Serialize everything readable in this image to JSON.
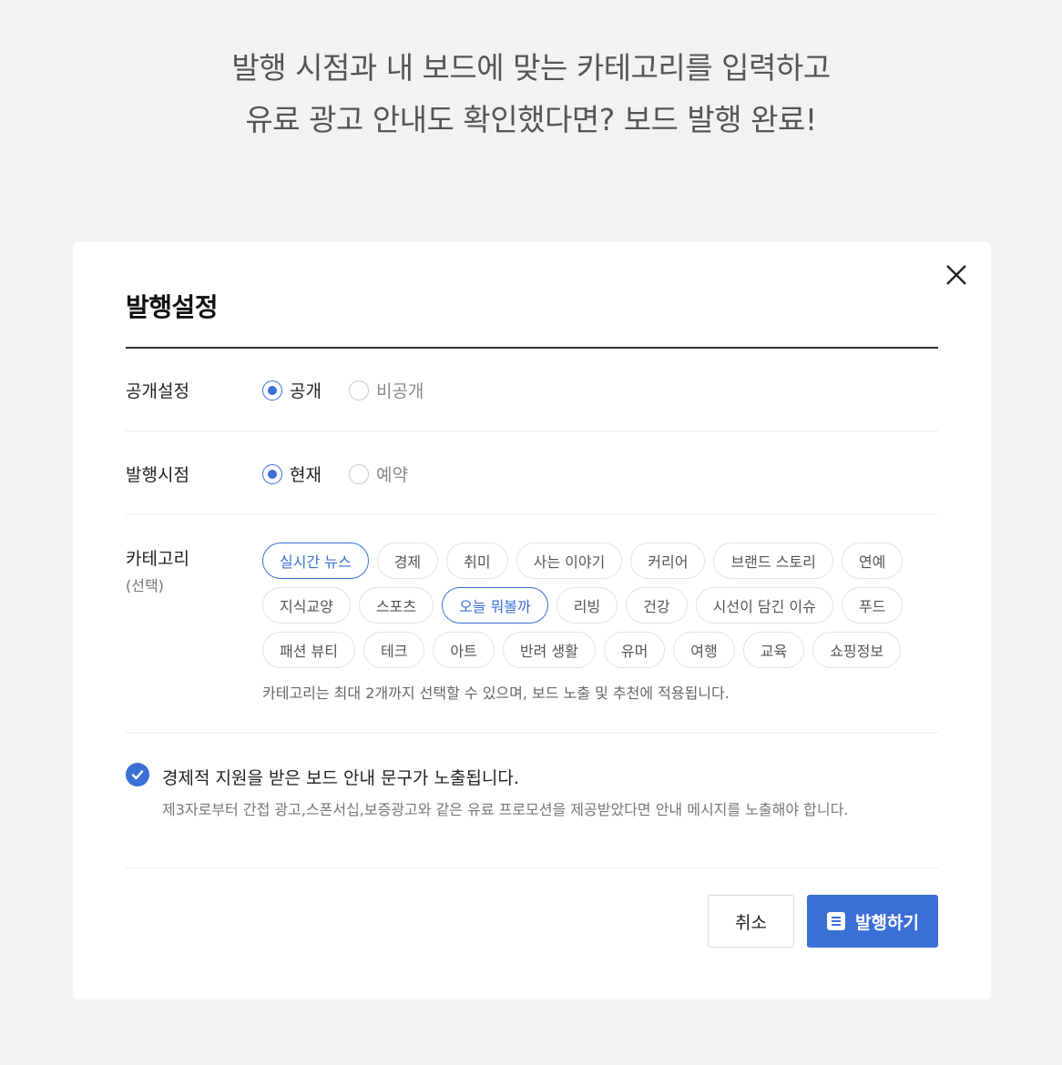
{
  "headline": {
    "line1": "발행 시점과 내 보드에 맞는 카테고리를 입력하고",
    "line2": "유료 광고 안내도 확인했다면? 보드 발행 완료!"
  },
  "modal": {
    "title": "발행설정",
    "close_icon": "close-icon",
    "visibility": {
      "label": "공개설정",
      "options": [
        {
          "label": "공개",
          "selected": true
        },
        {
          "label": "비공개",
          "selected": false
        }
      ]
    },
    "publish_time": {
      "label": "발행시점",
      "options": [
        {
          "label": "현재",
          "selected": true
        },
        {
          "label": "예약",
          "selected": false
        }
      ]
    },
    "category": {
      "label": "카테고리",
      "sublabel": "(선택)",
      "rows": [
        [
          "실시간 뉴스",
          "경제",
          "취미",
          "사는 이야기",
          "커리어",
          "브랜드 스토리",
          "연예"
        ],
        [
          "지식교양",
          "스포츠",
          "오늘 뭐볼까",
          "리빙",
          "건강",
          "시선이 담긴 이슈",
          "푸드"
        ],
        [
          "패션 뷰티",
          "테크",
          "아트",
          "반려 생활",
          "유머",
          "여행",
          "교육",
          "쇼핑정보"
        ]
      ],
      "selected": [
        "실시간 뉴스",
        "오늘 뭐볼까"
      ],
      "hint": "카테고리는 최대 2개까지 선택할 수 있으며, 보드 노출 및 추천에 적용됩니다."
    },
    "notice": {
      "checked": true,
      "title": "경제적 지원을 받은 보드 안내 문구가 노출됩니다.",
      "description": "제3자로부터 간접 광고,스폰서십,보증광고와 같은 유료 프로모션을 제공받았다면 안내 메시지를 노출해야 합니다."
    },
    "buttons": {
      "cancel": "취소",
      "publish": "발행하기"
    }
  },
  "colors": {
    "accent": "#3b6fd6",
    "background": "#f2f2f2"
  }
}
